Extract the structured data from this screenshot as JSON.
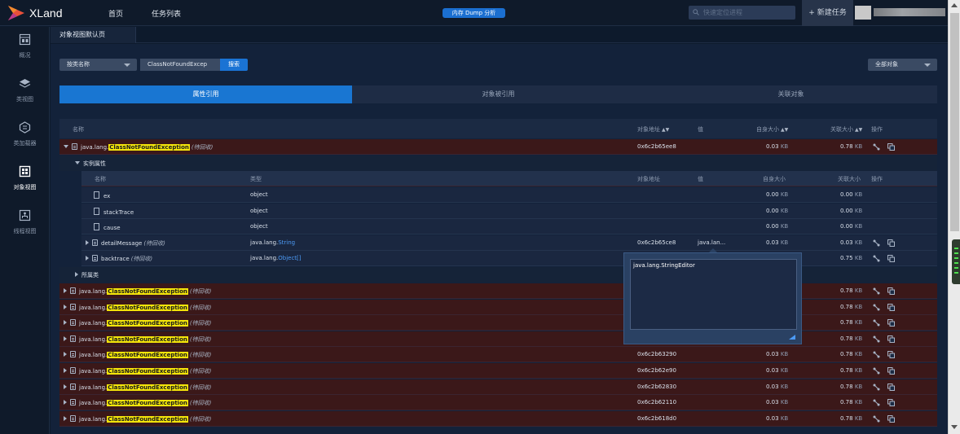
{
  "app": {
    "brand": "XLand",
    "nav": [
      "首页",
      "任务列表"
    ],
    "center_badge": "内存 Dump 分析",
    "search_placeholder": "快速定位进程",
    "new_task": "+ 新建任务"
  },
  "sidebar": {
    "items": [
      {
        "label": "概况",
        "icon": "overview-icon"
      },
      {
        "label": "类视图",
        "icon": "layers-icon"
      },
      {
        "label": "类加载器",
        "icon": "classloader-icon"
      },
      {
        "label": "对象视图",
        "icon": "object-view-icon",
        "active": true
      },
      {
        "label": "线程视图",
        "icon": "thread-view-icon"
      }
    ]
  },
  "page_tab": "对象视图默认页",
  "filter": {
    "mode": "按类名称",
    "query": "ClassNotFoundExcep",
    "search": "搜索",
    "scope": "全部对象"
  },
  "segments": [
    "属性引用",
    "对象被引用",
    "关联对象"
  ],
  "table": {
    "headers": {
      "name": "名称",
      "address": "对象地址",
      "value": "值",
      "self": "自身大小",
      "retained": "关联大小",
      "ops": "操作"
    },
    "expanded_row": {
      "prefix": "java.lang.",
      "hl": "ClassNotFoundException",
      "tag": "(待回收)",
      "address": "0x6c2b65ee8",
      "self": "0.03",
      "retained": "0.78",
      "unit": "KB"
    },
    "section_instance": "实例属性",
    "sub_headers": {
      "name": "名称",
      "type": "类型",
      "address": "对象地址",
      "value": "值",
      "self": "自身大小",
      "retained": "关联大小",
      "ops": "操作"
    },
    "fields": [
      {
        "name": "ex",
        "type_plain": "object",
        "type_prefix": "",
        "type_link": "",
        "address": "",
        "value": "",
        "self": "0.00",
        "retained": "0.00",
        "expandable": false
      },
      {
        "name": "stackTrace",
        "type_plain": "object",
        "type_prefix": "",
        "type_link": "",
        "address": "",
        "value": "",
        "self": "0.00",
        "retained": "0.00",
        "expandable": false
      },
      {
        "name": "cause",
        "type_plain": "object",
        "type_prefix": "",
        "type_link": "",
        "address": "",
        "value": "",
        "self": "0.00",
        "retained": "0.00",
        "expandable": false
      },
      {
        "name": "detailMessage",
        "tag": "(待回收)",
        "type_plain": "",
        "type_prefix": "java.lang.",
        "type_link": "String",
        "address": "0x6c2b65ce8",
        "value": "java.lan...",
        "self": "0.03",
        "retained": "0.03",
        "expandable": true
      },
      {
        "name": "backtrace",
        "tag": "(待回收)",
        "type_plain": "",
        "type_prefix": "java.lang.",
        "type_link": "Object[]",
        "address": "",
        "value": "",
        "self": "",
        "retained": "0.75",
        "expandable": true
      }
    ],
    "section_owner": "所属类",
    "rows": [
      {
        "prefix": "java.lang.",
        "hl": "ClassNotFoundException",
        "tag": "(待回收)",
        "address": "",
        "self": "",
        "retained": "0.78"
      },
      {
        "prefix": "java.lang.",
        "hl": "ClassNotFoundException",
        "tag": "(待回收)",
        "address": "",
        "self": "",
        "retained": "0.78"
      },
      {
        "prefix": "java.lang.",
        "hl": "ClassNotFoundException",
        "tag": "(待回收)",
        "address": "",
        "self": "",
        "retained": "0.78"
      },
      {
        "prefix": "java.lang.",
        "hl": "ClassNotFoundException",
        "tag": "(待回收)",
        "address": "",
        "self": "",
        "retained": "0.78"
      },
      {
        "prefix": "java.lang.",
        "hl": "ClassNotFoundException",
        "tag": "(待回收)",
        "address": "0x6c2b63290",
        "self": "0.03",
        "retained": "0.78"
      },
      {
        "prefix": "java.lang.",
        "hl": "ClassNotFoundException",
        "tag": "(待回收)",
        "address": "0x6c2b62e90",
        "self": "0.03",
        "retained": "0.78"
      },
      {
        "prefix": "java.lang.",
        "hl": "ClassNotFoundException",
        "tag": "(待回收)",
        "address": "0x6c2b62830",
        "self": "0.03",
        "retained": "0.78"
      },
      {
        "prefix": "java.lang.",
        "hl": "ClassNotFoundException",
        "tag": "(待回收)",
        "address": "0x6c2b62110",
        "self": "0.03",
        "retained": "0.78"
      },
      {
        "prefix": "java.lang.",
        "hl": "ClassNotFoundException",
        "tag": "(待回收)",
        "address": "0x6c2b618d0",
        "self": "0.03",
        "retained": "0.78"
      }
    ],
    "unit": "KB"
  },
  "popup": {
    "text": "java.lang.StringEditor"
  },
  "colors": {
    "accent": "#1976d2",
    "highlight": "#f4e50a",
    "row_red": "#3b1819",
    "bg": "#13223a"
  }
}
